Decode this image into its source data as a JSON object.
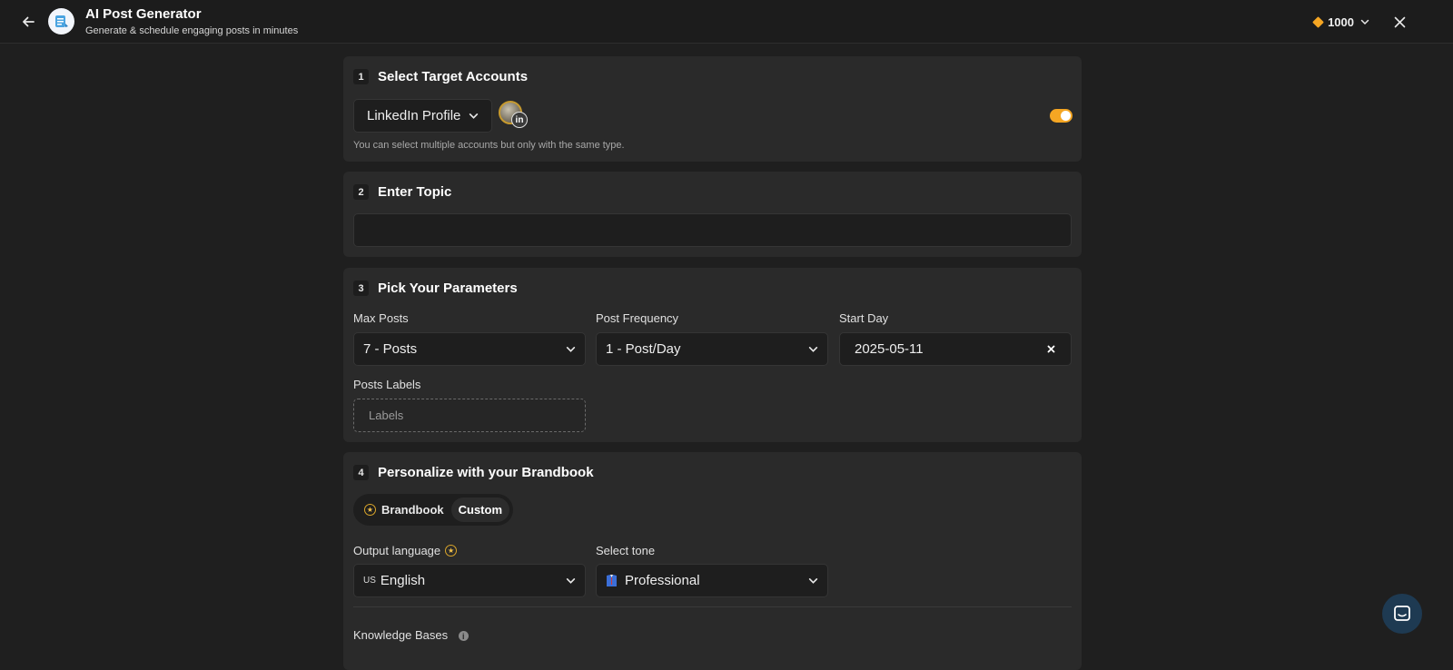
{
  "header": {
    "title": "AI Post Generator",
    "subtitle": "Generate & schedule engaging posts in minutes",
    "credits": "1000"
  },
  "step1": {
    "number": "1",
    "title": "Select Target Accounts",
    "account_type": "LinkedIn Profile",
    "account_badge": "in",
    "hint": "You can select multiple accounts but only with the same type.",
    "toggle_on": true
  },
  "step2": {
    "number": "2",
    "title": "Enter Topic",
    "topic_value": ""
  },
  "step3": {
    "number": "3",
    "title": "Pick Your Parameters",
    "max_posts_label": "Max Posts",
    "max_posts_value": "7 - Posts",
    "frequency_label": "Post Frequency",
    "frequency_value": "1 - Post/Day",
    "start_day_label": "Start Day",
    "start_day_value": "2025-05-11",
    "labels_label": "Posts Labels",
    "labels_placeholder": "Labels"
  },
  "step4": {
    "number": "4",
    "title": "Personalize with your Brandbook",
    "seg_brandbook": "Brandbook",
    "seg_custom": "Custom",
    "output_language_label": "Output language",
    "output_language_flag": "US",
    "output_language_value": "English",
    "tone_label": "Select tone",
    "tone_value": "Professional",
    "knowledge_label": "Knowledge Bases"
  },
  "colors": {
    "accent": "#f5a623",
    "background": "#1f1f1f",
    "panel": "#2a2a2a"
  }
}
